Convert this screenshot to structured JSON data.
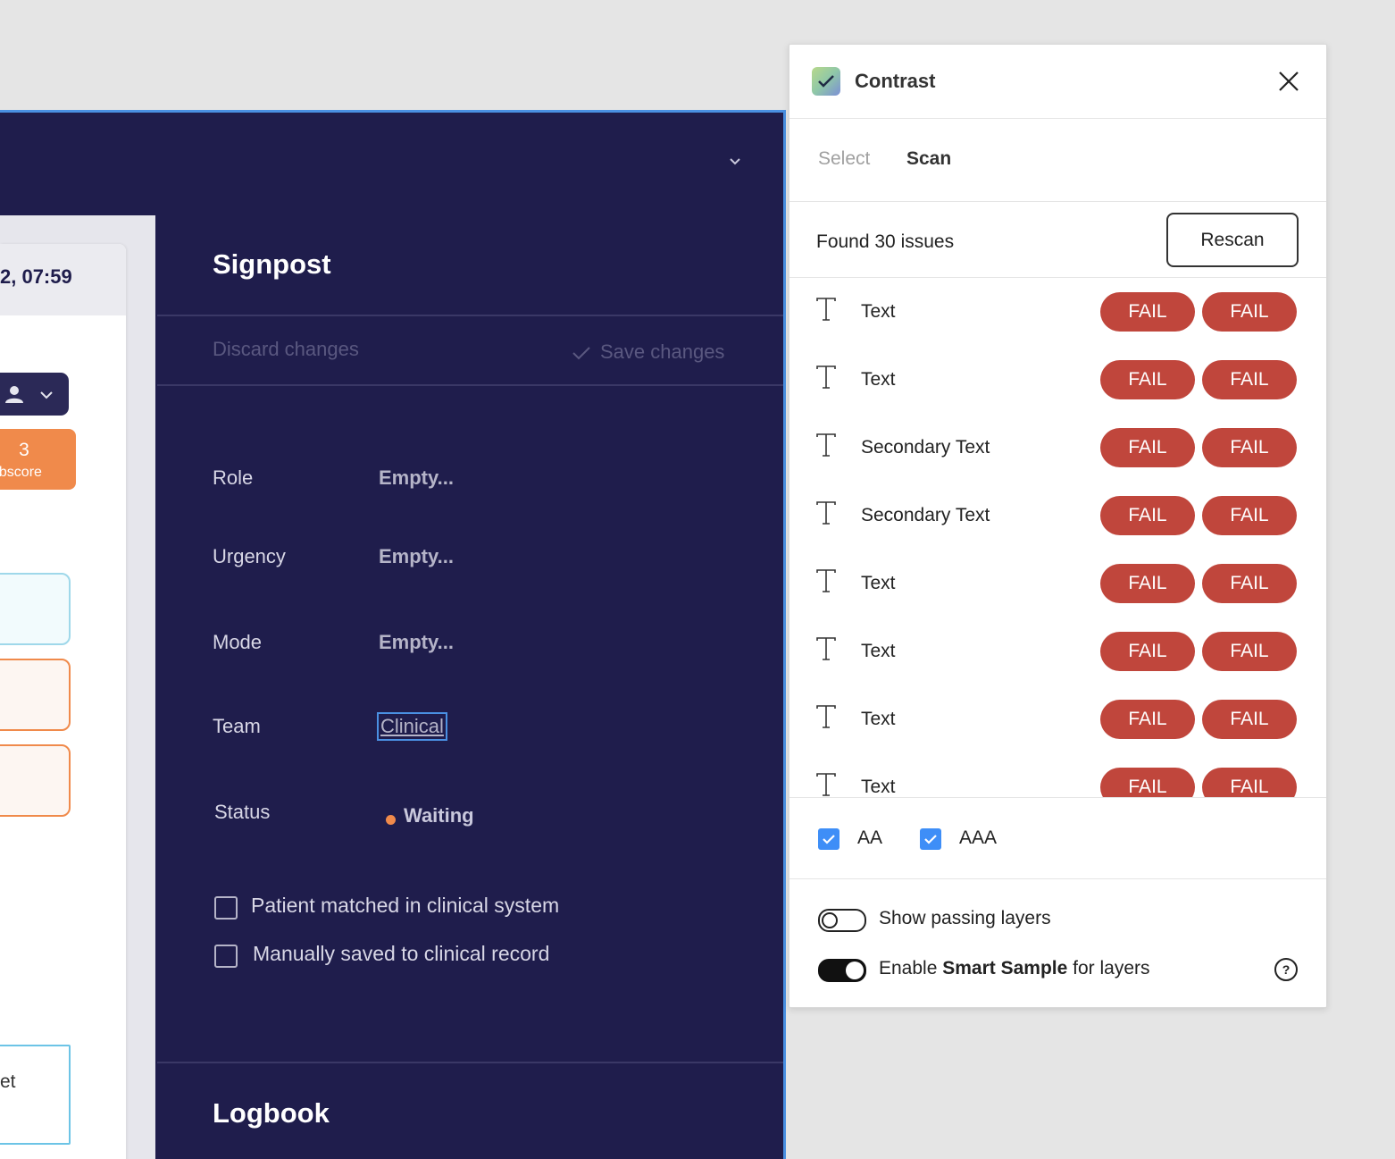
{
  "app": {
    "time_partial": "2, 07:59",
    "score": {
      "value": "3",
      "label": "ubscore"
    },
    "box4_text": "et",
    "signpost": {
      "title": "Signpost",
      "discard_label": "Discard changes",
      "save_label": "Save changes",
      "fields": [
        {
          "label": "Role",
          "value": "Empty..."
        },
        {
          "label": "Urgency",
          "value": "Empty..."
        },
        {
          "label": "Mode",
          "value": "Empty..."
        },
        {
          "label": "Team",
          "value": "Clinical"
        },
        {
          "label": "Status",
          "value": "Waiting"
        }
      ],
      "checkboxes": [
        "Patient matched in clinical system",
        "Manually saved to clinical record"
      ]
    },
    "logbook_title": "Logbook"
  },
  "plugin": {
    "title": "Contrast",
    "tabs": {
      "select": "Select",
      "scan": "Scan"
    },
    "found_text": "Found 30 issues",
    "rescan_label": "Rescan",
    "issues": [
      {
        "name": "Text",
        "aa": "FAIL",
        "aaa": "FAIL"
      },
      {
        "name": "Text",
        "aa": "FAIL",
        "aaa": "FAIL"
      },
      {
        "name": "Secondary Text",
        "aa": "FAIL",
        "aaa": "FAIL"
      },
      {
        "name": "Secondary Text",
        "aa": "FAIL",
        "aaa": "FAIL"
      },
      {
        "name": "Text",
        "aa": "FAIL",
        "aaa": "FAIL"
      },
      {
        "name": "Text",
        "aa": "FAIL",
        "aaa": "FAIL"
      },
      {
        "name": "Text",
        "aa": "FAIL",
        "aaa": "FAIL"
      },
      {
        "name": "Text",
        "aa": "FAIL",
        "aaa": "FAIL"
      }
    ],
    "levels": {
      "aa": "AA",
      "aaa": "AAA"
    },
    "show_passing_label": "Show passing layers",
    "smart_sample": {
      "pre": "Enable ",
      "bold": "Smart Sample",
      "post": " for layers"
    },
    "help_glyph": "?"
  },
  "colors": {
    "app_bg": "#1f1d4c",
    "fail_red": "#c0463c",
    "accent_blue": "#3e8ef7",
    "status_orange": "#f08a4b"
  }
}
